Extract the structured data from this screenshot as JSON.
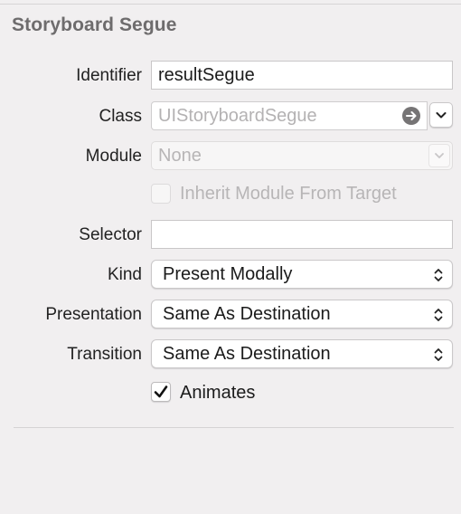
{
  "section": {
    "title": "Storyboard Segue"
  },
  "identifier": {
    "label": "Identifier",
    "value": "resultSegue"
  },
  "class_field": {
    "label": "Class",
    "placeholder": "UIStoryboardSegue",
    "arrow_icon": "arrow-right-circle-icon",
    "dropdown_icon": "chevron-down-icon"
  },
  "module": {
    "label": "Module",
    "value": "None",
    "dropdown_icon": "chevron-down-icon"
  },
  "inherit": {
    "label": "Inherit Module From Target",
    "checked": false,
    "enabled": false
  },
  "selector": {
    "label": "Selector",
    "value": ""
  },
  "kind": {
    "label": "Kind",
    "value": "Present Modally"
  },
  "presentation": {
    "label": "Presentation",
    "value": "Same As Destination"
  },
  "transition": {
    "label": "Transition",
    "value": "Same As Destination"
  },
  "animates": {
    "label": "Animates",
    "checked": true
  }
}
